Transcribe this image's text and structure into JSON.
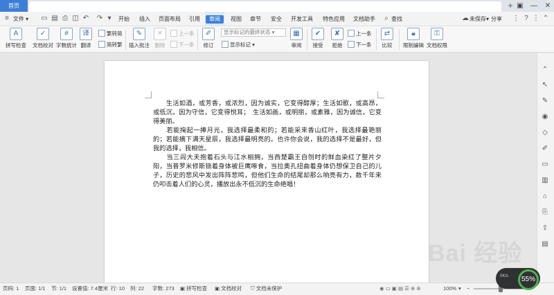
{
  "tabstrip": {
    "home": "首页"
  },
  "menubar": {
    "file": "文件",
    "items": [
      "开始",
      "插入",
      "页面布局",
      "引用",
      "审阅",
      "视图",
      "章节",
      "安全",
      "开发工具",
      "特色应用",
      "文档助手"
    ],
    "active": "审阅",
    "search": "查找",
    "unsaved": "未保存",
    "share": "分享"
  },
  "ribbon": {
    "spellcheck": "拼写检查",
    "proofread": "文档校对",
    "wordcount": "字数统计",
    "translate": "翻译",
    "to_traditional": "繁转简",
    "to_simplified": "简转繁",
    "insert_comment": "插入批注",
    "delete": "删除",
    "prev": "上一条",
    "next": "下一条",
    "revise": "修订",
    "markup_state": "显示标记的最终状态",
    "show_markup": "显示标记",
    "review": "审阅",
    "accept": "接受",
    "reject": "拒绝",
    "prev2": "上一条",
    "next2": "下一条",
    "compare": "比较",
    "restrict_edit": "限制编辑",
    "permissions": "文档权限"
  },
  "document": {
    "paragraphs": [
      "　　生活如酒，或芳香，或浓烈，因为诚实，它变得醇厚；生活如歌，或高昂，或低沉，因为守信，它变得悦耳；　生活如画，或明丽，或素雅，因为诚信，它变得美丽。",
      "　　若能掬起一捧月光，我选择最柔和的；若能采来香山红叶，我选择最艳丽的；若能摘下满天星辰，我选择最明亮的。也许你会说，我的选择不是最好，但我的选择，我相信。",
      "　　当三闾大夫抱着石头与江水相拥，当西楚霸王自刎时的鲜血染红了整片夕阳，当普罗米修斯锁着身体被巨鹰啄食，当拉奥孔扭曲着身体仍想保卫自己的儿子，历史的悲风中发出阵阵悲鸣，但他们生命的结尾却那么响亮有力，数千年来仍叩击着人们的心灵，播放出永不低沉的生命绝唱！"
    ]
  },
  "statusbar": {
    "page_num": "页码: 1",
    "pages": "页面: 1/1",
    "section": "节: 1/1",
    "setting": "设置值: 7.4厘米",
    "row": "行: 10",
    "col": "列: 22",
    "words": "字数: 273",
    "spellcheck": "拼写检查",
    "proofread": "文档校对",
    "protect": "文档未保护",
    "zoom": "100%"
  },
  "speed": {
    "value": "55%",
    "rate": "0K/s"
  },
  "watermark": "Bai 经验",
  "colors": {
    "accent": "#3c7fd8",
    "ribbon_bg": "#f7f7f7",
    "canvas": "#e6e6e6"
  }
}
